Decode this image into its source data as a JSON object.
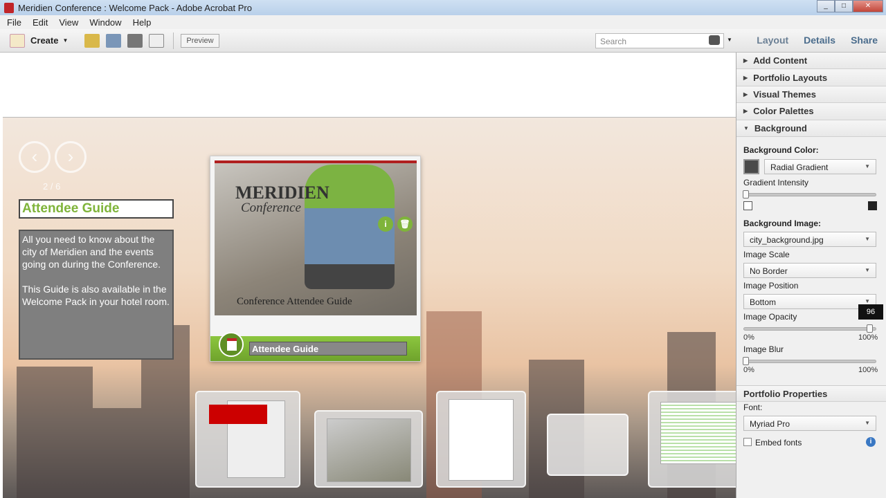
{
  "window": {
    "title": "Meridien Conference : Welcome Pack - Adobe Acrobat Pro",
    "controls": [
      "_",
      "□",
      "✕"
    ]
  },
  "menu": [
    "File",
    "Edit",
    "View",
    "Window",
    "Help"
  ],
  "toolbar": {
    "create_label": "Create",
    "preview_label": "Preview",
    "search_placeholder": "Search"
  },
  "tabs": {
    "layout": "Layout",
    "details": "Details",
    "share": "Share"
  },
  "portfolio": {
    "prev": "‹",
    "next": "›",
    "pager": "2 / 6",
    "title": "Attendee Guide",
    "desc1": "All you need to know about the city of Meridien and the events going on during the Conference.",
    "desc2": "This Guide is also available in the Welcome Pack in your hotel room.",
    "card": {
      "brand": "MERIDIEN",
      "sub": "Conference",
      "caption": "Conference Attendee Guide",
      "name": "Attendee Guide",
      "info": "i",
      "delete": "🗑"
    }
  },
  "panel": {
    "sections": [
      "Add Content",
      "Portfolio Layouts",
      "Visual Themes",
      "Color Palettes",
      "Background"
    ],
    "bg": {
      "color_label": "Background Color:",
      "color_value": "Radial Gradient",
      "swatch": "#4a4a4a",
      "gradient_label": "Gradient Intensity",
      "gradient_value": 0,
      "image_label": "Background Image:",
      "image_value": "city_background.jpg",
      "scale_label": "Image Scale",
      "scale_value": "No Border",
      "position_label": "Image Position",
      "position_value": "Bottom",
      "opacity_label": "Image Opacity",
      "opacity_value": 96,
      "opacity_tip": "96",
      "opacity_min": "0%",
      "opacity_max": "100%",
      "blur_label": "Image Blur",
      "blur_value": 0,
      "blur_min": "0%",
      "blur_max": "100%"
    },
    "props": {
      "header": "Portfolio Properties",
      "font_label": "Font:",
      "font_value": "Myriad Pro",
      "embed_label": "Embed fonts",
      "embed_checked": false
    }
  }
}
